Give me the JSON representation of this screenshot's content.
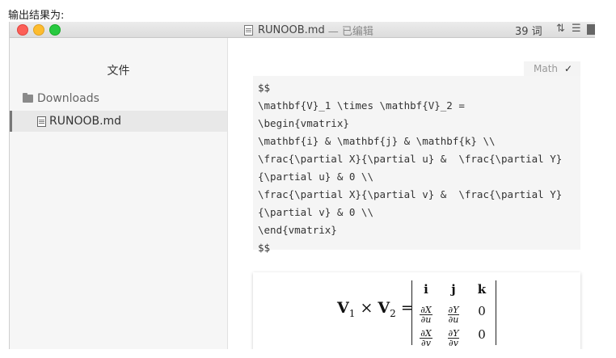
{
  "caption": "输出结果为:",
  "window": {
    "title": "RUNOOB.md",
    "title_state": "— 已编辑",
    "word_count": "39 词",
    "sort_icon": "up-down-chevron-icon",
    "outline_icon": "list-icon"
  },
  "sidebar": {
    "title": "文件",
    "folder": "Downloads",
    "file": "RUNOOB.md"
  },
  "editor": {
    "lang_label": "Math",
    "lang_check": "✓",
    "code_lines": [
      "$$",
      "\\mathbf{V}_1 \\times \\mathbf{V}_2 =",
      "\\begin{vmatrix}",
      "\\mathbf{i} & \\mathbf{j} & \\mathbf{k} \\\\",
      "\\frac{\\partial X}{\\partial u} &  \\frac{\\partial Y}",
      "{\\partial u} & 0 \\\\",
      "\\frac{\\partial X}{\\partial v} &  \\frac{\\partial Y}",
      "{\\partial v} & 0 \\\\",
      "\\end{vmatrix}",
      "$$"
    ],
    "render": {
      "lhs_v": "V",
      "lhs_sub1": "1",
      "times": "×",
      "lhs_sub2": "2",
      "equals": "=",
      "row1": [
        "i",
        "j",
        "k"
      ],
      "row2": {
        "a_num": "∂X",
        "a_den": "∂u",
        "b_num": "∂Y",
        "b_den": "∂u",
        "c": "0"
      },
      "row3": {
        "a_num": "∂X",
        "a_den": "∂v",
        "b_num": "∂Y",
        "b_den": "∂v",
        "c": "0"
      }
    }
  },
  "colors": {
    "titlebar": "#dcdcdc",
    "sidebar_bg": "#f6f6f6",
    "code_bg": "#f5f5f5",
    "code_green": "#2a7a2a",
    "code_blue": "#2a2aa0"
  }
}
